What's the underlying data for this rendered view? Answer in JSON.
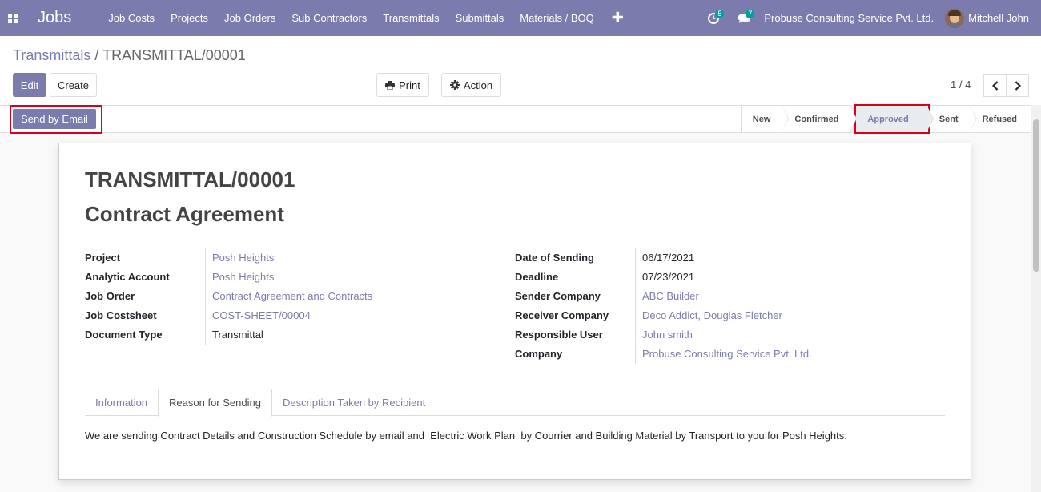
{
  "navbar": {
    "app_name": "Jobs",
    "menu": [
      "Job Costs",
      "Projects",
      "Job Orders",
      "Sub Contractors",
      "Transmittals",
      "Submittals",
      "Materials / BOQ"
    ],
    "plus_label": "✚",
    "activity_count": "5",
    "messages_count": "7",
    "company": "Probuse Consulting Service Pvt. Ltd.",
    "user": "Mitchell John"
  },
  "breadcrumb": {
    "parent": "Transmittals",
    "separator": "/",
    "current": "TRANSMITTAL/00001"
  },
  "toolbar": {
    "edit_label": "Edit",
    "create_label": "Create",
    "print_label": "Print",
    "action_label": "Action"
  },
  "pager": {
    "value": "1 / 4"
  },
  "statusbar": {
    "send_email_label": "Send by Email",
    "stages": [
      "New",
      "Confirmed",
      "Approved",
      "Sent",
      "Refused"
    ],
    "active_stage": "Approved"
  },
  "record": {
    "title": "TRANSMITTAL/00001",
    "subtitle": "Contract Agreement",
    "left_fields": [
      {
        "label": "Project",
        "value": "Posh Heights",
        "link": true
      },
      {
        "label": "Analytic Account",
        "value": "Posh Heights",
        "link": true
      },
      {
        "label": "Job Order",
        "value": "Contract Agreement and Contracts",
        "link": true
      },
      {
        "label": "Job Costsheet",
        "value": "COST-SHEET/00004",
        "link": true
      },
      {
        "label": "Document Type",
        "value": "Transmittal",
        "link": false
      }
    ],
    "right_fields": [
      {
        "label": "Date of Sending",
        "value": "06/17/2021",
        "link": false
      },
      {
        "label": "Deadline",
        "value": "07/23/2021",
        "link": false
      },
      {
        "label": "Sender Company",
        "value": "ABC Builder",
        "link": true
      },
      {
        "label": "Receiver Company",
        "value": "Deco Addict, Douglas Fletcher",
        "link": true
      },
      {
        "label": "Responsible User",
        "value": "John smith",
        "link": true
      },
      {
        "label": "Company",
        "value": "Probuse Consulting Service Pvt. Ltd.",
        "link": true
      }
    ]
  },
  "tabs": {
    "items": [
      "Information",
      "Reason for Sending",
      "Description Taken by Recipient"
    ],
    "active": "Reason for Sending",
    "content": "We are sending Contract Details and Construction Schedule by email and  Electric Work Plan  by Courrier and Building Material by Transport to you for Posh Heights."
  },
  "colors": {
    "brand": "#7c7bad",
    "badge": "#00a09d",
    "highlight": "#d9001b"
  },
  "icons": {
    "apps": "apps-grid-icon",
    "activity": "clock-icon",
    "messages": "chat-icon",
    "print": "print-icon",
    "action": "gear-icon",
    "prev": "chevron-left-icon",
    "next": "chevron-right-icon"
  }
}
